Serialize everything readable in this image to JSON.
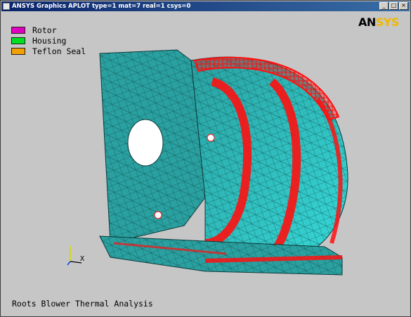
{
  "window": {
    "title": "ANSYS Graphics  APLOT  type=1 mat=7 real=1 csys=0",
    "minimize": "_",
    "maximize": "□",
    "close": "×"
  },
  "legend": [
    {
      "label": "Rotor",
      "color": "#e000c0"
    },
    {
      "label": "Housing",
      "color": "#00e020"
    },
    {
      "label": "Teflon Seal",
      "color": "#f0a000"
    }
  ],
  "logo": {
    "part1": "AN",
    "part2": "SYS"
  },
  "triad": {
    "x_label": "X"
  },
  "caption": "Roots Blower Thermal Analysis",
  "colors": {
    "background": "#c6c6c6",
    "mesh_fill": "#2aa0a0",
    "mesh_light": "#36d8d8",
    "nodes": "#ff1010"
  }
}
